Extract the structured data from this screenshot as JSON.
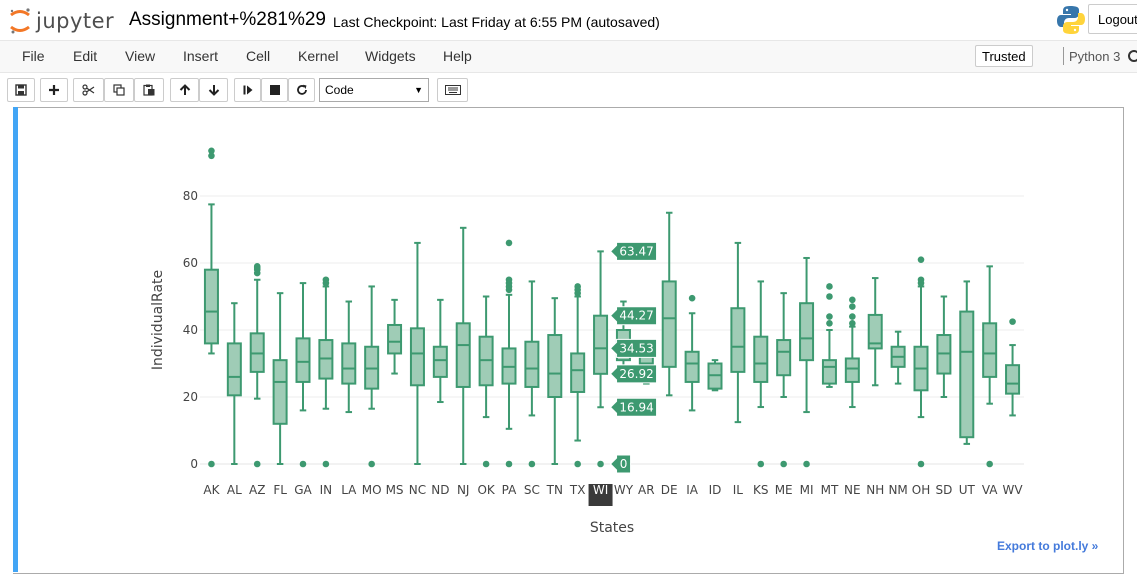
{
  "header": {
    "logo_text": "jupyter",
    "notebook_name": "Assignment+%281%29",
    "checkpoint": "Last Checkpoint: Last Friday at 6:55 PM (autosaved)",
    "logout_label": "Logout"
  },
  "menu": {
    "items": [
      "File",
      "Edit",
      "View",
      "Insert",
      "Cell",
      "Kernel",
      "Widgets",
      "Help"
    ],
    "trusted_label": "Trusted",
    "kernel_name": "Python 3"
  },
  "toolbar": {
    "cell_type": "Code",
    "icons": [
      "save-icon",
      "plus-icon",
      "cut-icon",
      "copy-icon",
      "paste-icon",
      "arrow-up-icon",
      "arrow-down-icon",
      "step-forward-icon",
      "stop-icon",
      "refresh-icon",
      "keyboard-icon"
    ]
  },
  "export_link": "Export to plot.ly »",
  "chart_data": {
    "type": "box",
    "xlabel": "States",
    "ylabel": "IndividualRate",
    "ylim": [
      -3,
      95
    ],
    "yticks": [
      0,
      20,
      40,
      60,
      80
    ],
    "color": "#3d9970",
    "grid": true,
    "hovered_category": "WI",
    "hover_labels": [
      {
        "label": "63.47",
        "value": 63.47
      },
      {
        "label": "44.27",
        "value": 44.27
      },
      {
        "label": "34.53",
        "value": 34.53
      },
      {
        "label": "26.92",
        "value": 26.92
      },
      {
        "label": "16.94",
        "value": 16.94
      },
      {
        "label": "0",
        "value": 0
      }
    ],
    "boxes": [
      {
        "category": "AK",
        "min": 33,
        "q1": 36,
        "median": 45.5,
        "q3": 58,
        "max": 77.5,
        "outliers": [
          0,
          92,
          93.5
        ]
      },
      {
        "category": "AL",
        "min": 0,
        "q1": 20.5,
        "median": 26,
        "q3": 36,
        "max": 48,
        "outliers": []
      },
      {
        "category": "AZ",
        "min": 19.5,
        "q1": 27.5,
        "median": 33,
        "q3": 39,
        "max": 55,
        "outliers": [
          0,
          57,
          58,
          58.5,
          59
        ]
      },
      {
        "category": "FL",
        "min": 0,
        "q1": 12,
        "median": 24.5,
        "q3": 31,
        "max": 51,
        "outliers": []
      },
      {
        "category": "GA",
        "min": 16,
        "q1": 24.5,
        "median": 30.5,
        "q3": 37.5,
        "max": 54,
        "outliers": [
          0
        ]
      },
      {
        "category": "IN",
        "min": 16.5,
        "q1": 25.5,
        "median": 31.5,
        "q3": 37,
        "max": 53,
        "outliers": [
          0,
          54,
          55
        ]
      },
      {
        "category": "LA",
        "min": 15.5,
        "q1": 24,
        "median": 28.5,
        "q3": 36,
        "max": 48.5,
        "outliers": []
      },
      {
        "category": "MO",
        "min": 16.5,
        "q1": 22.5,
        "median": 28.5,
        "q3": 35,
        "max": 53,
        "outliers": [
          0
        ]
      },
      {
        "category": "MS",
        "min": 27,
        "q1": 33,
        "median": 36.5,
        "q3": 41.5,
        "max": 49,
        "outliers": []
      },
      {
        "category": "NC",
        "min": 0,
        "q1": 23.5,
        "median": 33,
        "q3": 40.5,
        "max": 66,
        "outliers": []
      },
      {
        "category": "ND",
        "min": 18.5,
        "q1": 26,
        "median": 31,
        "q3": 35,
        "max": 49,
        "outliers": []
      },
      {
        "category": "NJ",
        "min": 0,
        "q1": 23,
        "median": 35.5,
        "q3": 42,
        "max": 70.5,
        "outliers": []
      },
      {
        "category": "OK",
        "min": 14,
        "q1": 23.5,
        "median": 31,
        "q3": 38,
        "max": 50,
        "outliers": [
          0
        ]
      },
      {
        "category": "PA",
        "min": 10.5,
        "q1": 24,
        "median": 29,
        "q3": 34.5,
        "max": 50.5,
        "outliers": [
          0,
          52,
          53,
          54,
          55,
          66
        ]
      },
      {
        "category": "SC",
        "min": 14.5,
        "q1": 23,
        "median": 28.5,
        "q3": 36.5,
        "max": 54.5,
        "outliers": [
          0
        ]
      },
      {
        "category": "TN",
        "min": 0,
        "q1": 20,
        "median": 27,
        "q3": 38.5,
        "max": 49.5,
        "outliers": []
      },
      {
        "category": "TX",
        "min": 7,
        "q1": 21.5,
        "median": 28,
        "q3": 33,
        "max": 50,
        "outliers": [
          0,
          51,
          52,
          53
        ]
      },
      {
        "category": "WI",
        "min": 16.94,
        "q1": 26.92,
        "median": 34.53,
        "q3": 44.27,
        "max": 63.47,
        "outliers": [
          0
        ]
      },
      {
        "category": "WY",
        "min": 29,
        "q1": 31,
        "median": 33,
        "q3": 40,
        "max": 48.5,
        "outliers": []
      },
      {
        "category": "AR",
        "min": 24,
        "q1": 27,
        "median": 30,
        "q3": 33,
        "max": 37,
        "outliers": []
      },
      {
        "category": "DE",
        "min": 20.5,
        "q1": 29,
        "median": 43.5,
        "q3": 54.5,
        "max": 75,
        "outliers": []
      },
      {
        "category": "IA",
        "min": 16,
        "q1": 24.5,
        "median": 30,
        "q3": 33.5,
        "max": 45,
        "outliers": [
          49.5
        ]
      },
      {
        "category": "ID",
        "min": 22,
        "q1": 22.5,
        "median": 26.5,
        "q3": 30,
        "max": 31,
        "outliers": []
      },
      {
        "category": "IL",
        "min": 12.5,
        "q1": 27.5,
        "median": 35,
        "q3": 46.5,
        "max": 66,
        "outliers": []
      },
      {
        "category": "KS",
        "min": 17,
        "q1": 24.5,
        "median": 30,
        "q3": 38,
        "max": 54.5,
        "outliers": [
          0
        ]
      },
      {
        "category": "ME",
        "min": 20,
        "q1": 26.5,
        "median": 33.5,
        "q3": 37,
        "max": 51,
        "outliers": [
          0
        ]
      },
      {
        "category": "MI",
        "min": 15.5,
        "q1": 31,
        "median": 37.5,
        "q3": 48,
        "max": 61.5,
        "outliers": [
          0
        ]
      },
      {
        "category": "MT",
        "min": 23,
        "q1": 24,
        "median": 29,
        "q3": 31,
        "max": 40,
        "outliers": [
          42,
          44,
          50,
          53
        ]
      },
      {
        "category": "NE",
        "min": 17,
        "q1": 24.5,
        "median": 28.5,
        "q3": 31.5,
        "max": 41,
        "outliers": [
          42,
          44,
          47,
          49
        ]
      },
      {
        "category": "NH",
        "min": 23.5,
        "q1": 34.5,
        "median": 36,
        "q3": 44.5,
        "max": 55.5,
        "outliers": []
      },
      {
        "category": "NM",
        "min": 24,
        "q1": 29,
        "median": 32,
        "q3": 35,
        "max": 39.5,
        "outliers": []
      },
      {
        "category": "OH",
        "min": 14,
        "q1": 22,
        "median": 28.5,
        "q3": 35,
        "max": 53,
        "outliers": [
          0,
          54,
          55,
          61
        ]
      },
      {
        "category": "SD",
        "min": 20,
        "q1": 27,
        "median": 33,
        "q3": 38.5,
        "max": 50,
        "outliers": []
      },
      {
        "category": "UT",
        "min": 6,
        "q1": 8,
        "median": 33.5,
        "q3": 45.5,
        "max": 54.5,
        "outliers": []
      },
      {
        "category": "VA",
        "min": 18,
        "q1": 26,
        "median": 33,
        "q3": 42,
        "max": 59,
        "outliers": [
          0
        ]
      },
      {
        "category": "WV",
        "min": 14.5,
        "q1": 21,
        "median": 24,
        "q3": 29.5,
        "max": 35.5,
        "outliers": [
          42.5
        ]
      }
    ]
  }
}
